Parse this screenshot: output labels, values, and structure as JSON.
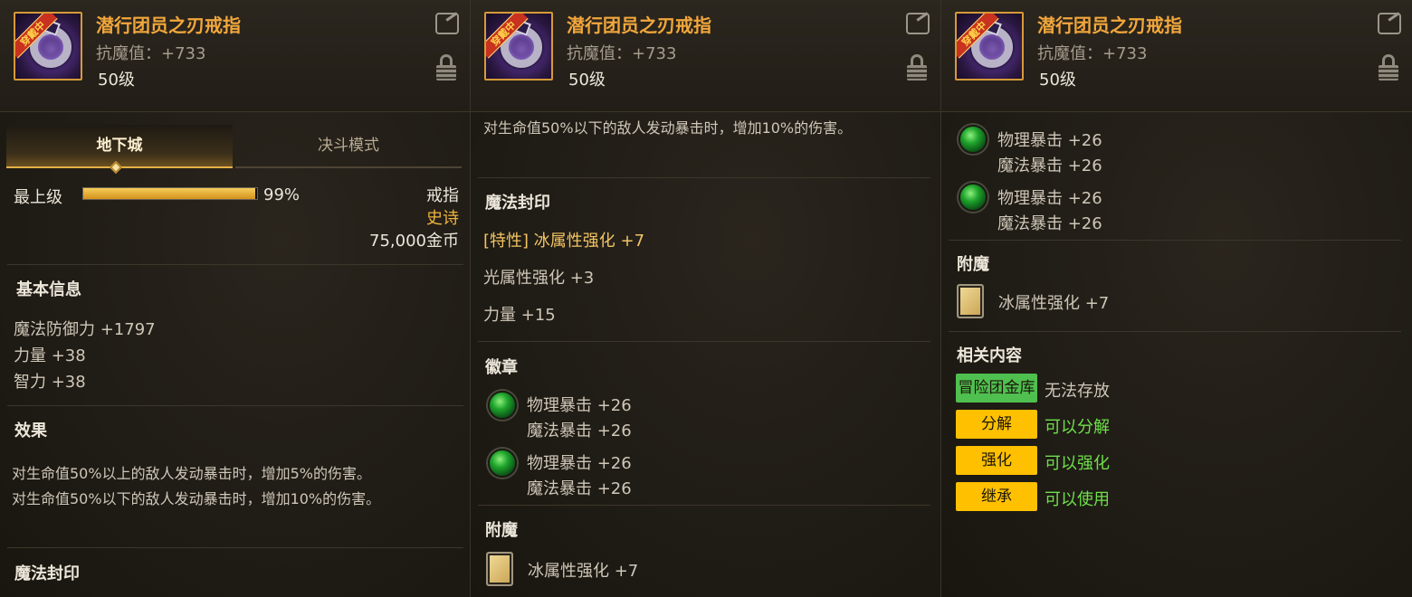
{
  "item": {
    "name": "潜行团员之刃戒指",
    "stat": "抗魔值：+733",
    "level": "50级",
    "badge": "穿戴中",
    "colors": {
      "title": "#f2a73c",
      "accent": "#e6b148"
    }
  },
  "panel1": {
    "tabs": [
      "地下城",
      "决斗模式"
    ],
    "grade_label": "最上级",
    "grade_percent": "99%",
    "grade_value": 0.99,
    "type": "戒指",
    "rarity": "史诗",
    "price": "75,000金币",
    "basic_title": "基本信息",
    "basic_stats": [
      "魔法防御力 +1797",
      "力量 +38",
      "智力 +38"
    ],
    "effect_title": "效果",
    "effects": [
      "对生命值50%以上的敌人发动暴击时，增加5%的伤害。",
      "对生命值50%以下的敌人发动暴击时，增加10%的伤害。"
    ],
    "seal_title": "魔法封印"
  },
  "panel2": {
    "effect_line": "对生命值50%以下的敌人发动暴击时，增加10%的伤害。",
    "seal_title": "魔法封印",
    "seal_lines": [
      "[特性] 冰属性强化 +7",
      "光属性强化 +3",
      "力量 +15"
    ],
    "emblem_title": "徽章",
    "emblems": [
      {
        "line1": "物理暴击 +26",
        "line2": "魔法暴击 +26"
      },
      {
        "line1": "物理暴击 +26",
        "line2": "魔法暴击 +26"
      }
    ],
    "enchant_title": "附魔",
    "enchant_text": "冰属性强化 +7"
  },
  "panel3": {
    "emblems": [
      {
        "line1": "物理暴击 +26",
        "line2": "魔法暴击 +26"
      },
      {
        "line1": "物理暴击 +26",
        "line2": "魔法暴击 +26"
      }
    ],
    "enchant_title": "附魔",
    "enchant_text": "冰属性强化 +7",
    "related_title": "相关内容",
    "related": [
      {
        "tag": "冒险团金库",
        "text": "无法存放",
        "tag_color": "green",
        "text_color": "#cfc7b8"
      },
      {
        "tag": "分解",
        "text": "可以分解",
        "tag_color": "yellow",
        "text_color": "#6ee04a"
      },
      {
        "tag": "强化",
        "text": "可以强化",
        "tag_color": "yellow",
        "text_color": "#6ee04a"
      },
      {
        "tag": "继承",
        "text": "可以使用",
        "tag_color": "yellow",
        "text_color": "#6ee04a"
      }
    ]
  }
}
